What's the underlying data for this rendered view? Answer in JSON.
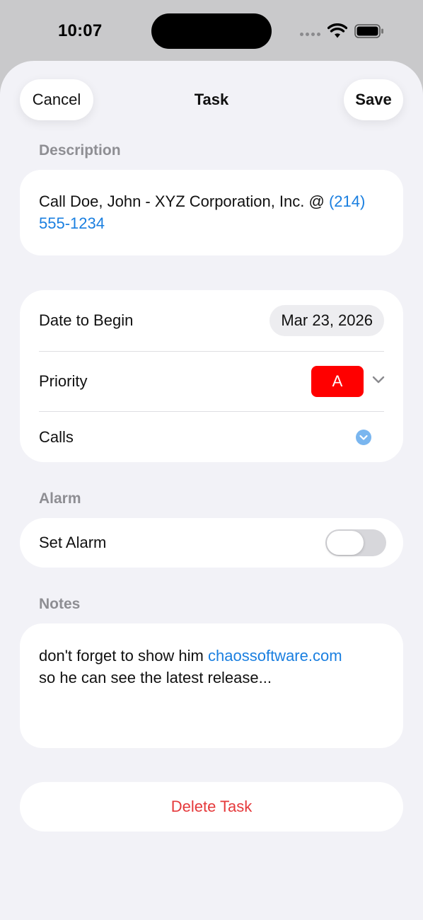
{
  "status_bar": {
    "time": "10:07"
  },
  "nav": {
    "cancel_label": "Cancel",
    "title": "Task",
    "save_label": "Save"
  },
  "description": {
    "header": "Description",
    "text": "Call Doe, John - XYZ Corporation, Inc. @",
    "phone": "(214) 555-1234"
  },
  "details": {
    "date_label": "Date to Begin",
    "date_value": "Mar 23, 2026",
    "priority_label": "Priority",
    "priority_value": "A",
    "calls_label": "Calls"
  },
  "alarm": {
    "header": "Alarm",
    "set_alarm_label": "Set Alarm",
    "enabled": false
  },
  "notes": {
    "header": "Notes",
    "text_before": "don't forget to show him",
    "link": "chaossoftware.com",
    "text_after": "so he can see the latest release..."
  },
  "delete_label": "Delete Task",
  "colors": {
    "link": "#1a7fe0",
    "priority_badge": "#ff0000",
    "delete": "#e5393b",
    "check_icon": "#7ab6ef",
    "section_header": "#8e8e93"
  }
}
